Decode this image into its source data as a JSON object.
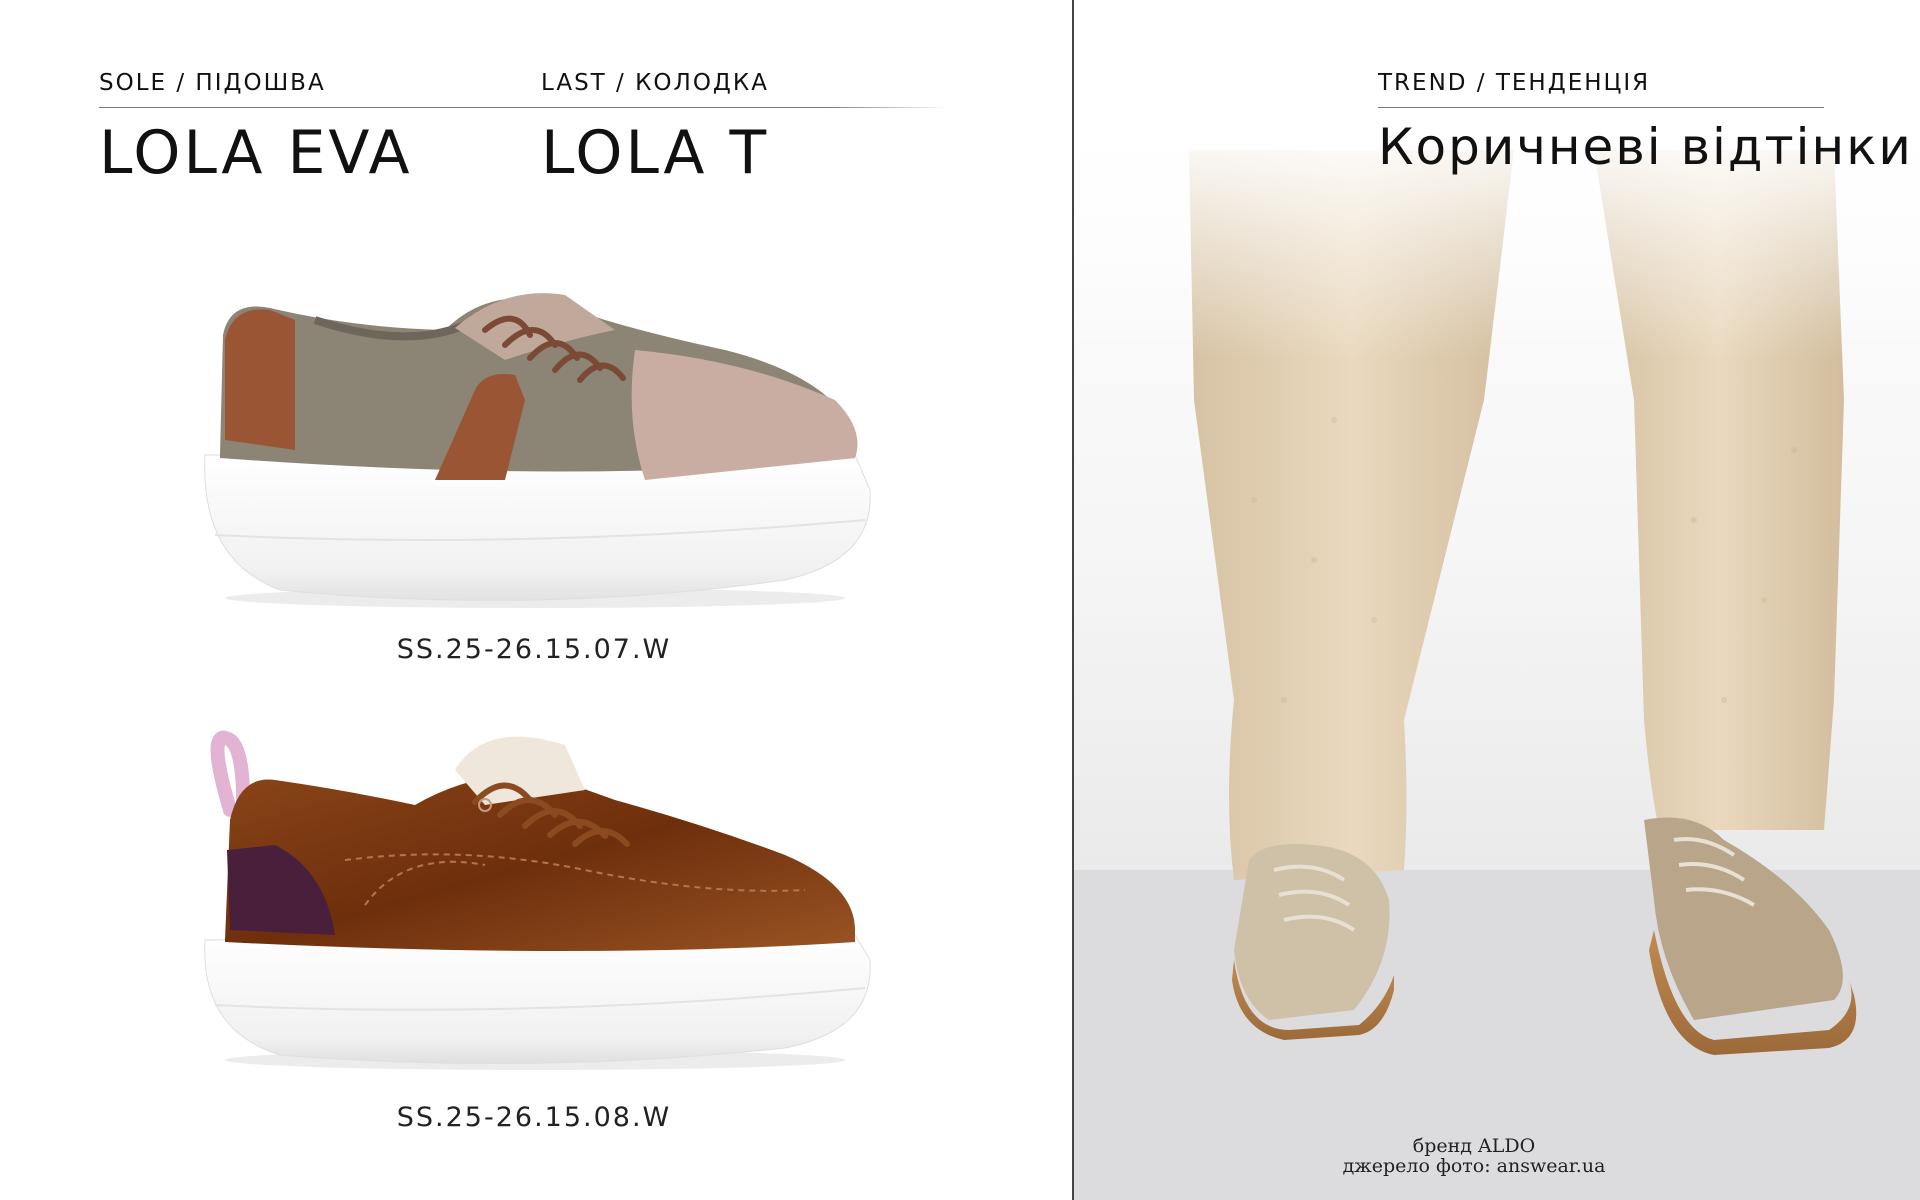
{
  "left": {
    "sole": {
      "label": "SOLE / ПІДОШВА",
      "value": "LOLA EVA"
    },
    "last": {
      "label": "LAST / КОЛОДКА",
      "value": "LOLA T"
    },
    "products": [
      {
        "article": "SS.25-26.15.07.W",
        "image": "taupe-platform-sneaker"
      },
      {
        "article": "SS.25-26.15.08.W",
        "image": "brown-velvet-platform-sneaker"
      }
    ]
  },
  "right": {
    "trend": {
      "label": "TREND / ТЕНДЕНЦІЯ",
      "value": "Коричневі відтінки"
    },
    "photo": "model-wearing-beige-sneakers",
    "credits": {
      "brand": "бренд ALDO",
      "source": "джерело фото: answear.ua"
    }
  },
  "colors": {
    "text": "#111111",
    "divider": "#444444",
    "taupe": "#8c8474",
    "caramel": "#9a5634",
    "velvet_brown": "#7a3a14",
    "sole_white": "#ffffff",
    "beige_trousers": "#e4d2b6",
    "gum_sole": "#b07a45"
  }
}
